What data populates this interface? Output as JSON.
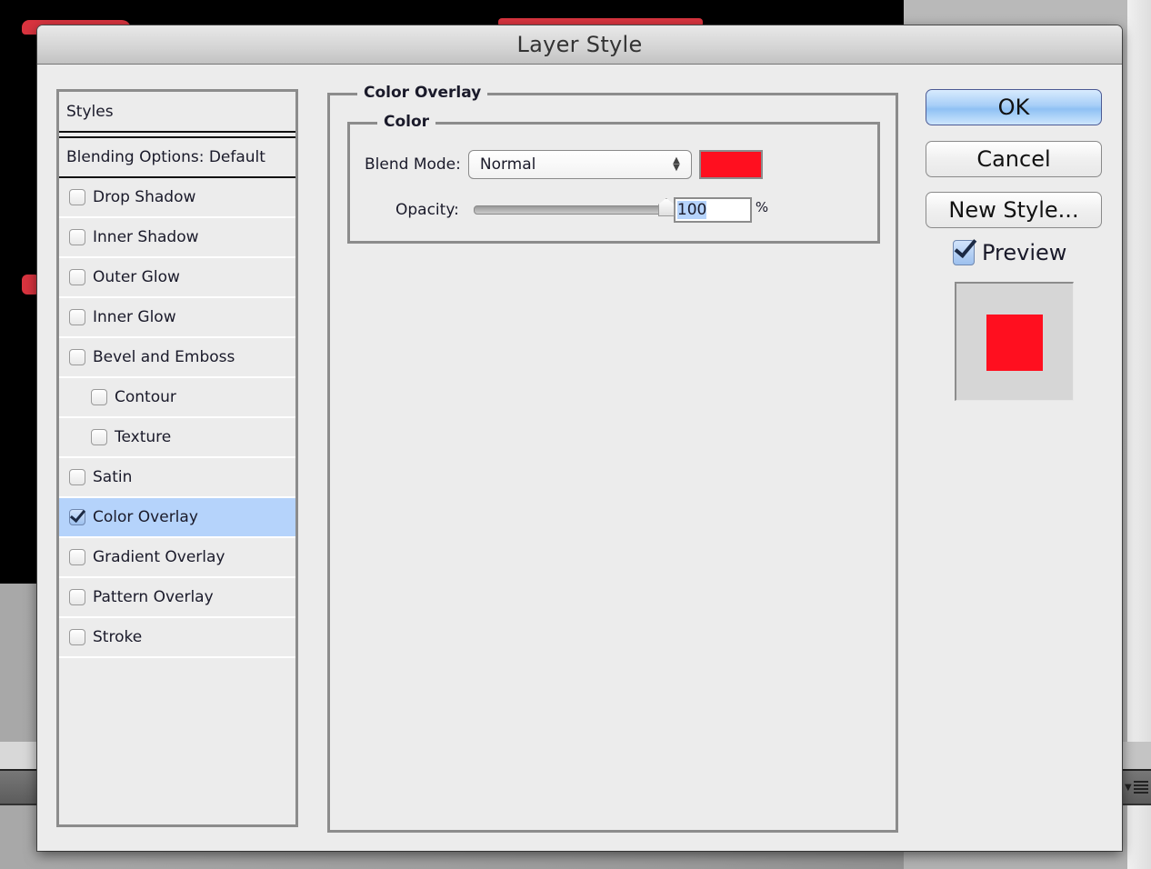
{
  "dialog": {
    "title": "Layer Style"
  },
  "styles_panel": {
    "header": "Styles",
    "blending_options": "Blending Options: Default",
    "items": [
      {
        "label": "Drop Shadow",
        "checked": false,
        "indent": false,
        "selected": false
      },
      {
        "label": "Inner Shadow",
        "checked": false,
        "indent": false,
        "selected": false
      },
      {
        "label": "Outer Glow",
        "checked": false,
        "indent": false,
        "selected": false
      },
      {
        "label": "Inner Glow",
        "checked": false,
        "indent": false,
        "selected": false
      },
      {
        "label": "Bevel and Emboss",
        "checked": false,
        "indent": false,
        "selected": false
      },
      {
        "label": "Contour",
        "checked": false,
        "indent": true,
        "selected": false
      },
      {
        "label": "Texture",
        "checked": false,
        "indent": true,
        "selected": false
      },
      {
        "label": "Satin",
        "checked": false,
        "indent": false,
        "selected": false
      },
      {
        "label": "Color Overlay",
        "checked": true,
        "indent": false,
        "selected": true
      },
      {
        "label": "Gradient Overlay",
        "checked": false,
        "indent": false,
        "selected": false
      },
      {
        "label": "Pattern Overlay",
        "checked": false,
        "indent": false,
        "selected": false
      },
      {
        "label": "Stroke",
        "checked": false,
        "indent": false,
        "selected": false
      }
    ]
  },
  "color_overlay": {
    "group_title": "Color Overlay",
    "subgroup_title": "Color",
    "blend_mode_label": "Blend Mode:",
    "blend_mode_value": "Normal",
    "overlay_color": "#ff0f1f",
    "opacity_label": "Opacity:",
    "opacity_value": "100",
    "opacity_percent": 100,
    "opacity_unit": "%"
  },
  "buttons": {
    "ok": "OK",
    "cancel": "Cancel",
    "new_style": "New Style..."
  },
  "preview": {
    "label": "Preview",
    "checked": true,
    "swatch_color": "#ff0f1f"
  },
  "colors": {
    "selection_highlight": "#b5d3fb",
    "dialog_bg": "#ececec"
  }
}
